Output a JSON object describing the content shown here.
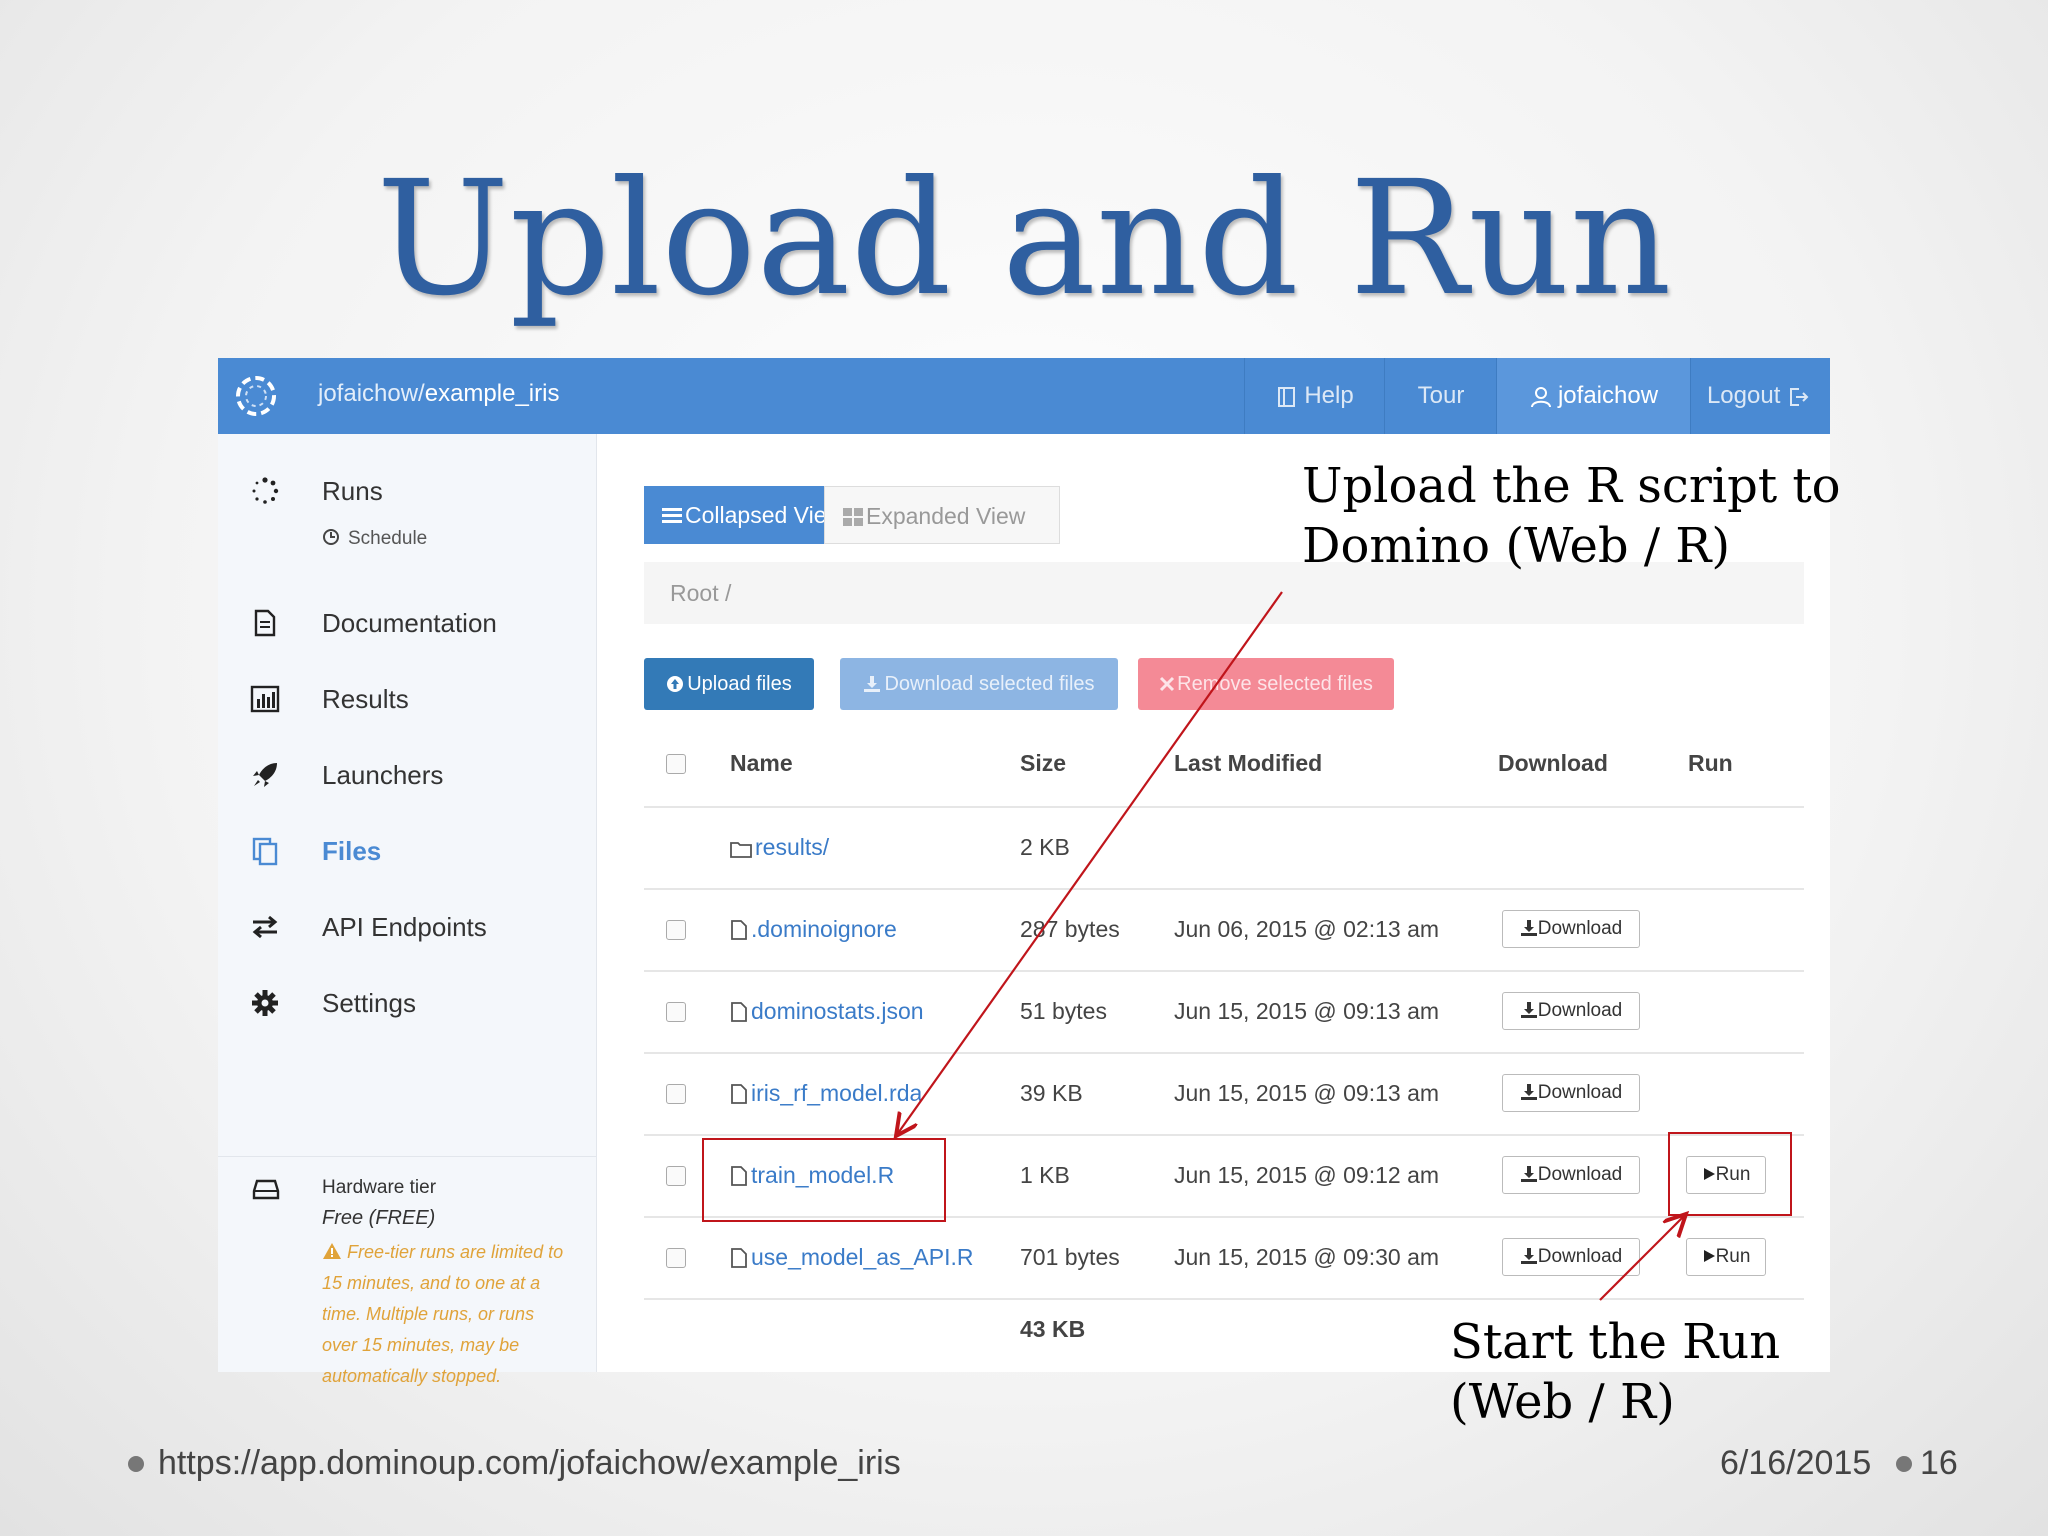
{
  "slide": {
    "title": "Upload and Run",
    "footer_url": "https://app.dominoup.com/jofaichow/example_iris",
    "footer_date": "6/16/2015",
    "page_number": "16"
  },
  "topbar": {
    "project_owner": "jofaichow/",
    "project_name": "example_iris",
    "help": "Help",
    "tour": "Tour",
    "user": "jofaichow",
    "logout": "Logout"
  },
  "sidebar": {
    "runs": "Runs",
    "schedule": "Schedule",
    "documentation": "Documentation",
    "results": "Results",
    "launchers": "Launchers",
    "files": "Files",
    "api_endpoints": "API Endpoints",
    "settings": "Settings",
    "hardware_title": "Hardware tier",
    "hardware_value": "Free (FREE)",
    "hardware_warning": "Free-tier runs are limited to 15 minutes, and to one at a time. Multiple runs, or runs over 15 minutes, may be automatically stopped."
  },
  "files": {
    "collapsed_view": "Collapsed View",
    "expanded_view": "Expanded View",
    "breadcrumb": "Root /",
    "upload_btn": "Upload files",
    "download_selected_btn": "Download selected files",
    "remove_selected_btn": "Remove selected files",
    "columns": {
      "name": "Name",
      "size": "Size",
      "modified": "Last Modified",
      "download": "Download",
      "run": "Run"
    },
    "rows": [
      {
        "name": "results/",
        "size": "2 KB",
        "modified": "",
        "download": "",
        "run": ""
      },
      {
        "name": ".dominoignore",
        "size": "287 bytes",
        "modified": "Jun 06, 2015 @ 02:13 am",
        "download": "Download",
        "run": ""
      },
      {
        "name": "dominostats.json",
        "size": "51 bytes",
        "modified": "Jun 15, 2015 @ 09:13 am",
        "download": "Download",
        "run": ""
      },
      {
        "name": "iris_rf_model.rda",
        "size": "39 KB",
        "modified": "Jun 15, 2015 @ 09:13 am",
        "download": "Download",
        "run": ""
      },
      {
        "name": "train_model.R",
        "size": "1 KB",
        "modified": "Jun 15, 2015 @ 09:12 am",
        "download": "Download",
        "run": "Run"
      },
      {
        "name": "use_model_as_API.R",
        "size": "701 bytes",
        "modified": "Jun 15, 2015 @ 09:30 am",
        "download": "Download",
        "run": "Run"
      }
    ],
    "total": "43 KB"
  },
  "annotations": {
    "upload_line1": "Upload the R script to",
    "upload_line2": "Domino (Web / R)",
    "run_line1": "Start the Run",
    "run_line2": "(Web / R)"
  },
  "colors": {
    "title": "#2f5fa0",
    "topbar": "#4a8ad3",
    "link": "#3a7bc8",
    "annotation_red": "#c0151b",
    "warning": "#e0a33a"
  }
}
